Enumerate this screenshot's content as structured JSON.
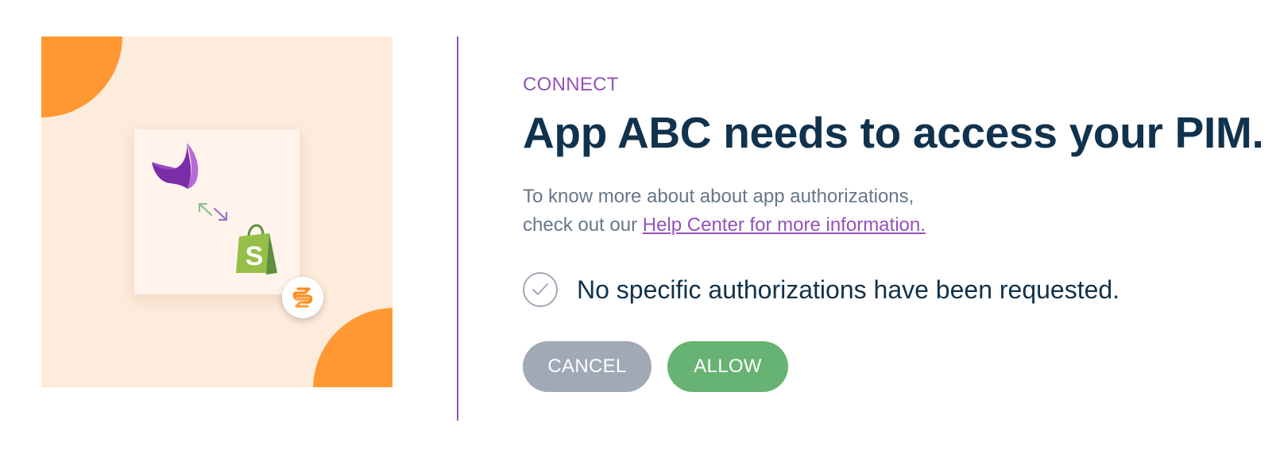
{
  "illustration": {
    "background_color": "#fdebdc",
    "accent_color": "#ff9832",
    "card_color": "#fff3ec",
    "icons": [
      "akeneo-logo-icon",
      "swap-arrows-icon",
      "shopify-logo-icon",
      "connector-logo-icon"
    ]
  },
  "divider_color": "#9452ba",
  "connect": {
    "subtitle": "CONNECT",
    "title": "App ABC needs to access your PIM.",
    "helper_line1": "To know more about about app authorizations,",
    "helper_line2_prefix": "check out our ",
    "help_link": "Help Center for more information.",
    "authorization_message": "No specific authorizations have been requested.",
    "check_icon": "check-circle-icon"
  },
  "actions": {
    "cancel_label": "CANCEL",
    "allow_label": "ALLOW"
  },
  "colors": {
    "brand_purple": "#9452ba",
    "title_text": "#11324d",
    "helper_text": "#67768a",
    "cancel_button": "#a1a9b7",
    "allow_button": "#67b373"
  }
}
